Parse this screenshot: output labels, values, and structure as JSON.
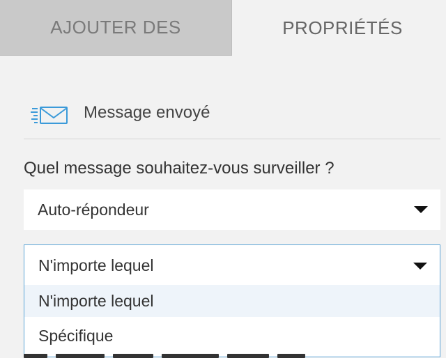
{
  "tabs": {
    "add_label": "AJOUTER DES",
    "properties_label": "PROPRIÉTÉS"
  },
  "trigger": {
    "icon": "sent-mail-icon",
    "label": "Message envoyé"
  },
  "question": "Quel message souhaitez-vous surveiller ?",
  "message_type_select": {
    "value": "Auto-répondeur"
  },
  "message_select": {
    "value": "N'importe lequel",
    "options": [
      "N'importe lequel",
      "Spécifique"
    ],
    "highlighted_index": 0
  },
  "colors": {
    "focus_border": "#5ba4d6",
    "option_hover": "#eef4fa",
    "icon": "#3b9ad9",
    "inactive_tab": "#c9c9c9"
  }
}
